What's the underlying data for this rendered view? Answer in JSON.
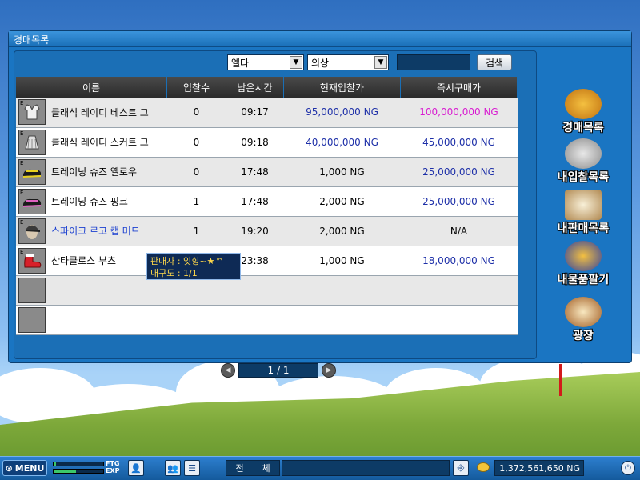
{
  "window": {
    "title": "경매목록"
  },
  "filters": {
    "category1": "엘다",
    "category2": "의상",
    "search_value": "",
    "search_label": "검색"
  },
  "columns": [
    "이름",
    "입찰수",
    "남은시간",
    "현재입찰가",
    "즉시구매가"
  ],
  "rows": [
    {
      "icon": "vest-icon",
      "name": "클래식 레이디 베스트 그",
      "bids": "0",
      "time": "09:17",
      "current": "95,000,000 NG",
      "buyout": "100,000,000 NG",
      "buyout_color": "pink"
    },
    {
      "icon": "skirt-icon",
      "name": "클래식 레이디 스커트 그",
      "bids": "0",
      "time": "09:18",
      "current": "40,000,000 NG",
      "buyout": "45,000,000 NG",
      "current_color": "blue"
    },
    {
      "icon": "yellow-shoe-icon",
      "name": "트레이닝 슈즈 옐로우",
      "bids": "0",
      "time": "17:48",
      "current": "1,000 NG",
      "buyout": "25,000,000 NG"
    },
    {
      "icon": "pink-shoe-icon",
      "name": "트레이닝 슈즈 핑크",
      "bids": "1",
      "time": "17:48",
      "current": "2,000 NG",
      "buyout": "25,000,000 NG"
    },
    {
      "icon": "cap-icon",
      "name": "스파이크 로고 캡 머드",
      "bids": "1",
      "time": "19:20",
      "current": "2,000 NG",
      "buyout": "N/A",
      "name_color": "link"
    },
    {
      "icon": "boots-icon",
      "name": "산타클로스 부츠",
      "bids": "",
      "time": "23:38",
      "current": "1,000 NG",
      "buyout": "18,000,000 NG"
    }
  ],
  "tooltip": {
    "line1": "판매자 : 잇힝~★™",
    "line2": "내구도 : 1/1"
  },
  "pager": {
    "label": "1 / 1"
  },
  "side_menu": [
    {
      "label": "경매목록",
      "icon": "auction-icon"
    },
    {
      "label": "내입찰목록",
      "icon": "cart-icon"
    },
    {
      "label": "내판매목록",
      "icon": "clipboard-icon"
    },
    {
      "label": "내물품팔기",
      "icon": "sell-icon"
    },
    {
      "label": "광장",
      "icon": "plaza-icon"
    }
  ],
  "bottom": {
    "menu_label": "MENU",
    "ftg_label": "FTG",
    "exp_label": "EXP",
    "ftg_fill": 0.05,
    "exp_fill": 0.45,
    "chat_mode_1": "전",
    "chat_mode_2": "체",
    "money": "1,372,561,650 NG"
  }
}
